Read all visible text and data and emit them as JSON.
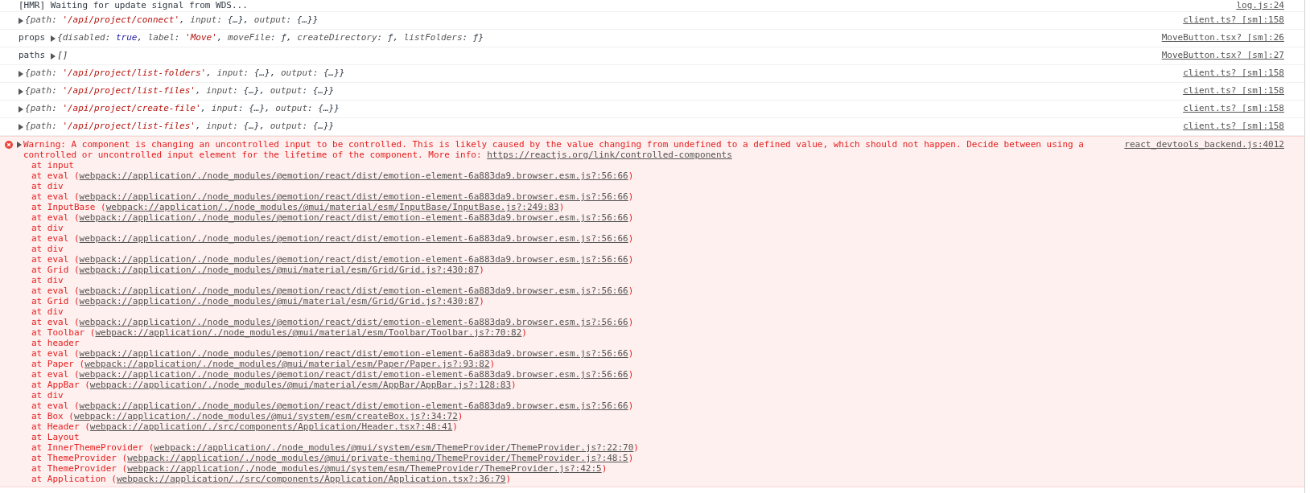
{
  "messages": [
    {
      "kind": "text",
      "text": "[HMR] Waiting for update signal from WDS...",
      "source": "log.js:24"
    },
    {
      "kind": "object",
      "parts": [
        {
          "text": "{",
          "kind": "punct"
        },
        {
          "text": "path",
          "kind": "key"
        },
        {
          "text": ": ",
          "kind": "punct"
        },
        {
          "text": "'/api/project/connect'",
          "kind": "string"
        },
        {
          "text": ", ",
          "kind": "punct"
        },
        {
          "text": "input",
          "kind": "key"
        },
        {
          "text": ": ",
          "kind": "punct"
        },
        {
          "text": "{…}",
          "kind": "value"
        },
        {
          "text": ", ",
          "kind": "punct"
        },
        {
          "text": "output",
          "kind": "key"
        },
        {
          "text": ": ",
          "kind": "punct"
        },
        {
          "text": "{…}",
          "kind": "value"
        },
        {
          "text": "}",
          "kind": "punct"
        }
      ],
      "source": "client.ts? [sm]:158"
    },
    {
      "kind": "object",
      "label": "props",
      "parts": [
        {
          "text": "{",
          "kind": "punct"
        },
        {
          "text": "disabled",
          "kind": "key"
        },
        {
          "text": ": ",
          "kind": "punct"
        },
        {
          "text": "true",
          "kind": "boolean"
        },
        {
          "text": ", ",
          "kind": "punct"
        },
        {
          "text": "label",
          "kind": "key"
        },
        {
          "text": ": ",
          "kind": "punct"
        },
        {
          "text": "'Move'",
          "kind": "string"
        },
        {
          "text": ", ",
          "kind": "punct"
        },
        {
          "text": "moveFile",
          "kind": "key"
        },
        {
          "text": ": ",
          "kind": "punct"
        },
        {
          "text": "ƒ",
          "kind": "value"
        },
        {
          "text": ", ",
          "kind": "punct"
        },
        {
          "text": "createDirectory",
          "kind": "key"
        },
        {
          "text": ": ",
          "kind": "punct"
        },
        {
          "text": "ƒ",
          "kind": "value"
        },
        {
          "text": ", ",
          "kind": "punct"
        },
        {
          "text": "listFolders",
          "kind": "key"
        },
        {
          "text": ": ",
          "kind": "punct"
        },
        {
          "text": "ƒ",
          "kind": "value"
        },
        {
          "text": "}",
          "kind": "punct"
        }
      ],
      "source": "MoveButton.tsx? [sm]:26"
    },
    {
      "kind": "object",
      "label": "paths",
      "parts": [
        {
          "text": "[]",
          "kind": "value"
        }
      ],
      "source": "MoveButton.tsx? [sm]:27"
    },
    {
      "kind": "object",
      "parts": [
        {
          "text": "{",
          "kind": "punct"
        },
        {
          "text": "path",
          "kind": "key"
        },
        {
          "text": ": ",
          "kind": "punct"
        },
        {
          "text": "'/api/project/list-folders'",
          "kind": "string"
        },
        {
          "text": ", ",
          "kind": "punct"
        },
        {
          "text": "input",
          "kind": "key"
        },
        {
          "text": ": ",
          "kind": "punct"
        },
        {
          "text": "{…}",
          "kind": "value"
        },
        {
          "text": ", ",
          "kind": "punct"
        },
        {
          "text": "output",
          "kind": "key"
        },
        {
          "text": ": ",
          "kind": "punct"
        },
        {
          "text": "{…}",
          "kind": "value"
        },
        {
          "text": "}",
          "kind": "punct"
        }
      ],
      "source": "client.ts? [sm]:158"
    },
    {
      "kind": "object",
      "parts": [
        {
          "text": "{",
          "kind": "punct"
        },
        {
          "text": "path",
          "kind": "key"
        },
        {
          "text": ": ",
          "kind": "punct"
        },
        {
          "text": "'/api/project/list-files'",
          "kind": "string"
        },
        {
          "text": ", ",
          "kind": "punct"
        },
        {
          "text": "input",
          "kind": "key"
        },
        {
          "text": ": ",
          "kind": "punct"
        },
        {
          "text": "{…}",
          "kind": "value"
        },
        {
          "text": ", ",
          "kind": "punct"
        },
        {
          "text": "output",
          "kind": "key"
        },
        {
          "text": ": ",
          "kind": "punct"
        },
        {
          "text": "{…}",
          "kind": "value"
        },
        {
          "text": "}",
          "kind": "punct"
        }
      ],
      "source": "client.ts? [sm]:158"
    },
    {
      "kind": "object",
      "parts": [
        {
          "text": "{",
          "kind": "punct"
        },
        {
          "text": "path",
          "kind": "key"
        },
        {
          "text": ": ",
          "kind": "punct"
        },
        {
          "text": "'/api/project/create-file'",
          "kind": "string"
        },
        {
          "text": ", ",
          "kind": "punct"
        },
        {
          "text": "input",
          "kind": "key"
        },
        {
          "text": ": ",
          "kind": "punct"
        },
        {
          "text": "{…}",
          "kind": "value"
        },
        {
          "text": ", ",
          "kind": "punct"
        },
        {
          "text": "output",
          "kind": "key"
        },
        {
          "text": ": ",
          "kind": "punct"
        },
        {
          "text": "{…}",
          "kind": "value"
        },
        {
          "text": "}",
          "kind": "punct"
        }
      ],
      "source": "client.ts? [sm]:158"
    },
    {
      "kind": "object",
      "parts": [
        {
          "text": "{",
          "kind": "punct"
        },
        {
          "text": "path",
          "kind": "key"
        },
        {
          "text": ": ",
          "kind": "punct"
        },
        {
          "text": "'/api/project/list-files'",
          "kind": "string"
        },
        {
          "text": ", ",
          "kind": "punct"
        },
        {
          "text": "input",
          "kind": "key"
        },
        {
          "text": ": ",
          "kind": "punct"
        },
        {
          "text": "{…}",
          "kind": "value"
        },
        {
          "text": ", ",
          "kind": "punct"
        },
        {
          "text": "output",
          "kind": "key"
        },
        {
          "text": ": ",
          "kind": "punct"
        },
        {
          "text": "{…}",
          "kind": "value"
        },
        {
          "text": "}",
          "kind": "punct"
        }
      ],
      "source": "client.ts? [sm]:158"
    },
    {
      "kind": "error",
      "message": "Warning: A component is changing an uncontrolled input to be controlled. This is likely caused by the value changing from undefined to a defined value, which should not happen. Decide between using a controlled or uncontrolled input element for the lifetime of the component. More info: ",
      "link": "https://reactjs.org/link/controlled-components",
      "source": "react_devtools_backend.js:4012",
      "stack": [
        {
          "text": "at input"
        },
        {
          "text": "at eval (",
          "link": "webpack://application/./node_modules/@emotion/react/dist/emotion-element-6a883da9.browser.esm.js?:56:66",
          "end": ")"
        },
        {
          "text": "at div"
        },
        {
          "text": "at eval (",
          "link": "webpack://application/./node_modules/@emotion/react/dist/emotion-element-6a883da9.browser.esm.js?:56:66",
          "end": ")"
        },
        {
          "text": "at InputBase (",
          "link": "webpack://application/./node_modules/@mui/material/esm/InputBase/InputBase.js?:249:83",
          "end": ")"
        },
        {
          "text": "at eval (",
          "link": "webpack://application/./node_modules/@emotion/react/dist/emotion-element-6a883da9.browser.esm.js?:56:66",
          "end": ")"
        },
        {
          "text": "at div"
        },
        {
          "text": "at eval (",
          "link": "webpack://application/./node_modules/@emotion/react/dist/emotion-element-6a883da9.browser.esm.js?:56:66",
          "end": ")"
        },
        {
          "text": "at div"
        },
        {
          "text": "at eval (",
          "link": "webpack://application/./node_modules/@emotion/react/dist/emotion-element-6a883da9.browser.esm.js?:56:66",
          "end": ")"
        },
        {
          "text": "at Grid (",
          "link": "webpack://application/./node_modules/@mui/material/esm/Grid/Grid.js?:430:87",
          "end": ")"
        },
        {
          "text": "at div"
        },
        {
          "text": "at eval (",
          "link": "webpack://application/./node_modules/@emotion/react/dist/emotion-element-6a883da9.browser.esm.js?:56:66",
          "end": ")"
        },
        {
          "text": "at Grid (",
          "link": "webpack://application/./node_modules/@mui/material/esm/Grid/Grid.js?:430:87",
          "end": ")"
        },
        {
          "text": "at div"
        },
        {
          "text": "at eval (",
          "link": "webpack://application/./node_modules/@emotion/react/dist/emotion-element-6a883da9.browser.esm.js?:56:66",
          "end": ")"
        },
        {
          "text": "at Toolbar (",
          "link": "webpack://application/./node_modules/@mui/material/esm/Toolbar/Toolbar.js?:70:82",
          "end": ")"
        },
        {
          "text": "at header"
        },
        {
          "text": "at eval (",
          "link": "webpack://application/./node_modules/@emotion/react/dist/emotion-element-6a883da9.browser.esm.js?:56:66",
          "end": ")"
        },
        {
          "text": "at Paper (",
          "link": "webpack://application/./node_modules/@mui/material/esm/Paper/Paper.js?:93:82",
          "end": ")"
        },
        {
          "text": "at eval (",
          "link": "webpack://application/./node_modules/@emotion/react/dist/emotion-element-6a883da9.browser.esm.js?:56:66",
          "end": ")"
        },
        {
          "text": "at AppBar (",
          "link": "webpack://application/./node_modules/@mui/material/esm/AppBar/AppBar.js?:128:83",
          "end": ")"
        },
        {
          "text": "at div"
        },
        {
          "text": "at eval (",
          "link": "webpack://application/./node_modules/@emotion/react/dist/emotion-element-6a883da9.browser.esm.js?:56:66",
          "end": ")"
        },
        {
          "text": "at Box (",
          "link": "webpack://application/./node_modules/@mui/system/esm/createBox.js?:34:72",
          "end": ")"
        },
        {
          "text": "at Header (",
          "link": "webpack://application/./src/components/Application/Header.tsx?:48:41",
          "end": ")"
        },
        {
          "text": "at Layout"
        },
        {
          "text": "at InnerThemeProvider (",
          "link": "webpack://application/./node_modules/@mui/system/esm/ThemeProvider/ThemeProvider.js?:22:70",
          "end": ")"
        },
        {
          "text": "at ThemeProvider (",
          "link": "webpack://application/./node_modules/@mui/private-theming/ThemeProvider/ThemeProvider.js?:48:5",
          "end": ")"
        },
        {
          "text": "at ThemeProvider (",
          "link": "webpack://application/./node_modules/@mui/system/esm/ThemeProvider/ThemeProvider.js?:42:5",
          "end": ")"
        },
        {
          "text": "at Application (",
          "link": "webpack://application/./src/components/Application/Application.tsx?:36:79",
          "end": ")"
        }
      ]
    }
  ]
}
